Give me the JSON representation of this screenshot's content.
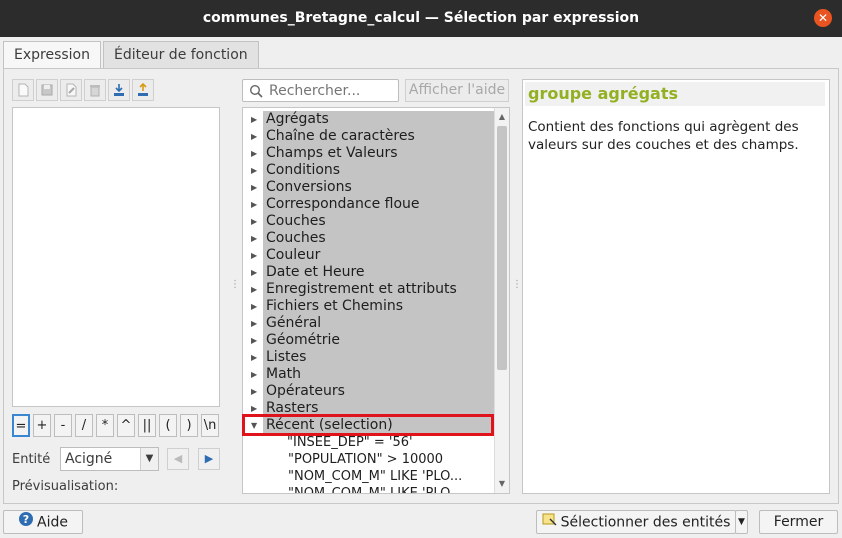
{
  "window": {
    "title": "communes_Bretagne_calcul — Sélection par expression",
    "close_icon": "close-icon"
  },
  "tabs": [
    {
      "label": "Expression"
    },
    {
      "label": "Éditeur de fonction"
    }
  ],
  "left": {
    "toolbar": [
      "new-file-icon",
      "save-icon",
      "edit-icon",
      "delete-icon",
      "import-icon",
      "export-icon"
    ],
    "operators": [
      "=",
      "+",
      "-",
      "/",
      "*",
      "^",
      "||",
      "(",
      ")",
      "\\n"
    ],
    "entity_label": "Entité",
    "entity_value": "Acigné",
    "preview_label": "Prévisualisation:"
  },
  "search": {
    "placeholder": "Rechercher..."
  },
  "help_button": "Afficher l'aide",
  "tree": {
    "groups": [
      "Agrégats",
      "Chaîne de caractères",
      "Champs et Valeurs",
      "Conditions",
      "Conversions",
      "Correspondance floue",
      "Couches",
      "Couches",
      "Couleur",
      "Date et Heure",
      "Enregistrement et attributs",
      "Fichiers et Chemins",
      "Général",
      "Géométrie",
      "Listes",
      "Math",
      "Opérateurs",
      "Rasters"
    ],
    "recent_group": "Récent (selection)",
    "recent_items": [
      "\"INSEE_DEP\" = '56'",
      "\"POPULATION\" > 10000",
      "\"NOM_COM_M\"  LIKE 'PLO...",
      "\"NOM_COM_M\"  LIKE 'PLO..."
    ]
  },
  "help_panel": {
    "title": "groupe agrégats",
    "body": "Contient des fonctions qui agrègent des valeurs sur des couches et des champs."
  },
  "footer": {
    "help": "Aide",
    "select": "Sélectionner des entités",
    "close": "Fermer"
  },
  "colors": {
    "highlight": "#e0121b",
    "help_title": "#93b023",
    "close_button": "#e95420"
  }
}
